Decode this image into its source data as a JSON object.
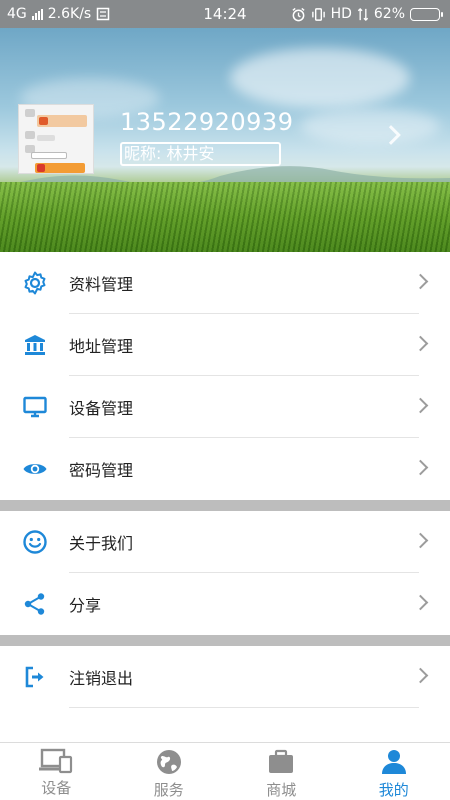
{
  "status_bar": {
    "network": "4G",
    "speed": "2.6K/s",
    "time": "14:24",
    "hd": "HD",
    "battery": "62%",
    "battery_level": 0.62
  },
  "profile": {
    "phone": "13522920939",
    "nickname": "昵称: 林井安"
  },
  "menu_groups": [
    {
      "items": [
        {
          "label": "资料管理",
          "icon": "gear-icon"
        },
        {
          "label": "地址管理",
          "icon": "bank-icon"
        },
        {
          "label": "设备管理",
          "icon": "monitor-icon"
        },
        {
          "label": "密码管理",
          "icon": "eye-icon"
        }
      ]
    },
    {
      "items": [
        {
          "label": "关于我们",
          "icon": "smiley-icon"
        },
        {
          "label": "分享",
          "icon": "share-icon"
        }
      ]
    },
    {
      "items": [
        {
          "label": "注销退出",
          "icon": "logout-icon"
        }
      ]
    }
  ],
  "tabs": [
    {
      "label": "设备",
      "icon": "devices-icon",
      "active": false
    },
    {
      "label": "服务",
      "icon": "globe-icon",
      "active": false
    },
    {
      "label": "商城",
      "icon": "briefcase-icon",
      "active": false
    },
    {
      "label": "我的",
      "icon": "person-icon",
      "active": true
    }
  ],
  "colors": {
    "accent": "#1e88d8",
    "inactive": "#8e8e8e",
    "separator": "#bdbdbd"
  }
}
